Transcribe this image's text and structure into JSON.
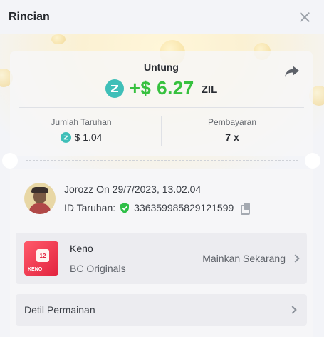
{
  "header": {
    "title": "Rincian"
  },
  "summary": {
    "profit_label": "Untung",
    "profit_amount": "+$ 6.27",
    "profit_currency": "ZIL",
    "bet_label": "Jumlah Taruhan",
    "bet_value": "$ 1.04",
    "payout_label": "Pembayaran",
    "payout_value": "7 x"
  },
  "user": {
    "name_line": "Jorozz On 29/7/2023, 13.02.04",
    "bet_id_label": "ID Taruhan:",
    "bet_id": "336359985829121599"
  },
  "game": {
    "name": "Keno",
    "provider": "BC Originals",
    "play_label": "Mainkan Sekarang",
    "logo_number": "12",
    "logo_text": "KENO"
  },
  "details": {
    "label": "Detil Permainan"
  },
  "colors": {
    "profit": "#37c13f",
    "zil": "#3fbfb8",
    "verified": "#2fbf48"
  },
  "icons": [
    "close-icon",
    "share-icon",
    "zil-coin-icon",
    "verified-shield-icon",
    "copy-icon",
    "chevron-right-icon"
  ]
}
